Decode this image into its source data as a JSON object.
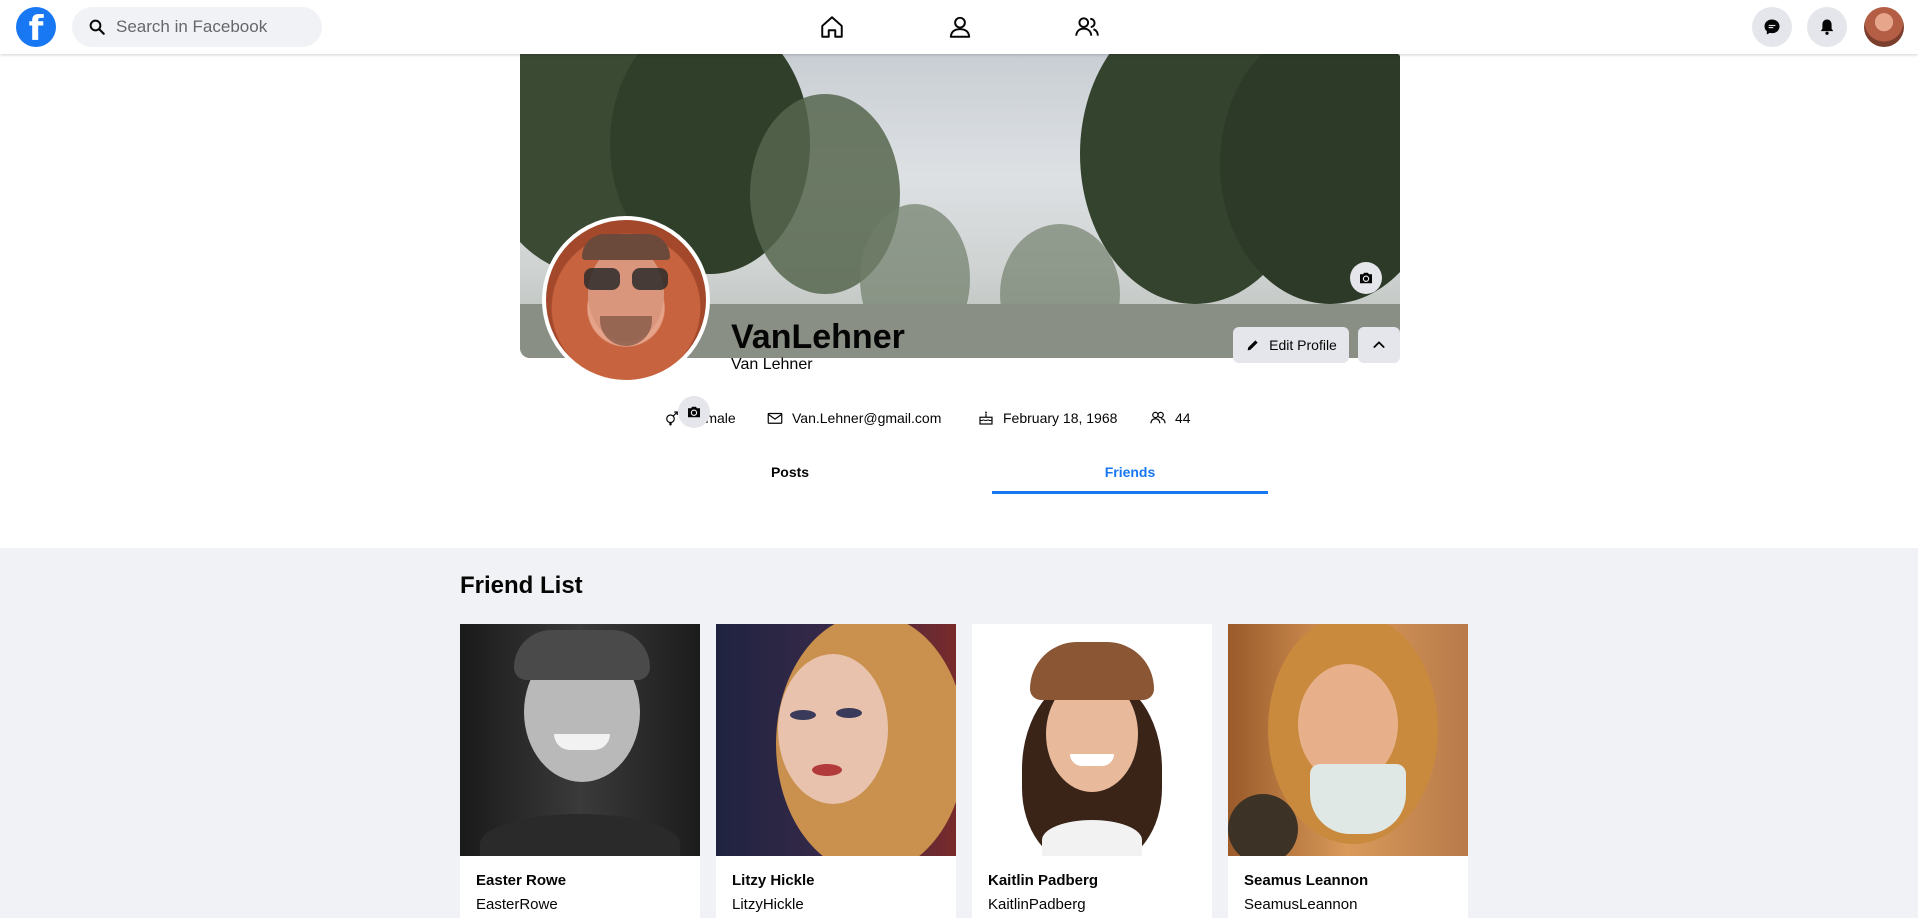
{
  "header": {
    "logo_letter": "f",
    "search_placeholder": "Search in Facebook"
  },
  "nav": {
    "icons": [
      "home-icon",
      "profile-icon",
      "friends-icon"
    ],
    "right_icons": [
      "messenger-icon",
      "notifications-icon",
      "account-avatar"
    ]
  },
  "profile": {
    "display_name": "VanLehner",
    "full_name": "Van Lehner",
    "edit_label": "Edit Profile",
    "gender": "Female",
    "email": "Van.Lehner@gmail.com",
    "birthday": "February 18, 1968",
    "friends_count": "44"
  },
  "tabs": [
    {
      "label": "Posts",
      "active": false
    },
    {
      "label": "Friends",
      "active": true
    }
  ],
  "friends": {
    "title": "Friend List",
    "items": [
      {
        "name": "Easter Rowe",
        "username": "EasterRowe"
      },
      {
        "name": "Litzy Hickle",
        "username": "LitzyHickle"
      },
      {
        "name": "Kaitlin Padberg",
        "username": "KaitlinPadberg"
      },
      {
        "name": "Seamus Leannon",
        "username": "SeamusLeannon"
      }
    ]
  },
  "colors": {
    "accent": "#1877f2",
    "page_bg": "#f0f2f5",
    "button_bg": "#e4e6eb"
  }
}
